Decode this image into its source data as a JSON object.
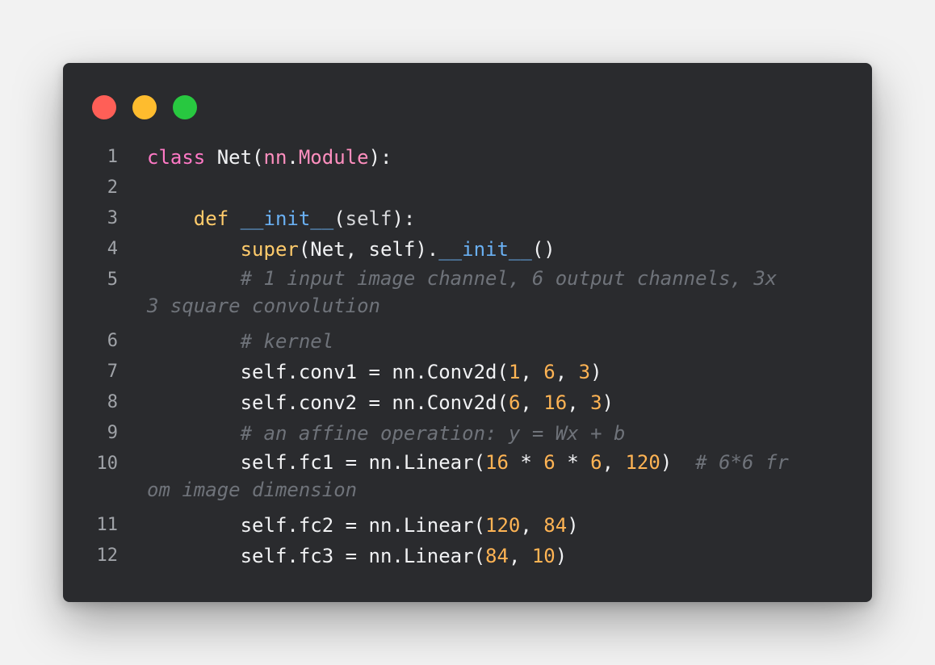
{
  "window": {
    "controls": [
      "close",
      "minimize",
      "maximize"
    ],
    "colors": {
      "close": "#ff5f57",
      "minimize": "#febc2e",
      "maximize": "#28c840",
      "background": "#2a2b2e"
    }
  },
  "code": {
    "language": "python",
    "lines": [
      {
        "n": "1",
        "tokens": [
          {
            "t": "class ",
            "c": "kw2"
          },
          {
            "t": "Net(",
            "c": "plain"
          },
          {
            "t": "nn",
            "c": "cls"
          },
          {
            "t": ".",
            "c": "plain"
          },
          {
            "t": "Module",
            "c": "cls"
          },
          {
            "t": "):",
            "c": "plain"
          }
        ]
      },
      {
        "n": "2",
        "tokens": [
          {
            "t": "",
            "c": "plain"
          }
        ]
      },
      {
        "n": "3",
        "tokens": [
          {
            "t": "    ",
            "c": "plain"
          },
          {
            "t": "def ",
            "c": "kw"
          },
          {
            "t": "__init__",
            "c": "fn"
          },
          {
            "t": "(",
            "c": "plain"
          },
          {
            "t": "self",
            "c": "self"
          },
          {
            "t": "):",
            "c": "plain"
          }
        ]
      },
      {
        "n": "4",
        "tokens": [
          {
            "t": "        ",
            "c": "plain"
          },
          {
            "t": "super",
            "c": "bi"
          },
          {
            "t": "(Net, self).",
            "c": "plain"
          },
          {
            "t": "__init__",
            "c": "fn"
          },
          {
            "t": "()",
            "c": "plain"
          }
        ]
      },
      {
        "n": "5",
        "tokens": [
          {
            "t": "        ",
            "c": "plain"
          },
          {
            "t": "# 1 input image channel, 6 output channels, 3x\n3 square convolution",
            "c": "cmt"
          }
        ]
      },
      {
        "n": "6",
        "tokens": [
          {
            "t": "        ",
            "c": "plain"
          },
          {
            "t": "# kernel",
            "c": "cmt"
          }
        ]
      },
      {
        "n": "7",
        "tokens": [
          {
            "t": "        self.conv1 = nn.Conv2d(",
            "c": "plain"
          },
          {
            "t": "1",
            "c": "num"
          },
          {
            "t": ", ",
            "c": "plain"
          },
          {
            "t": "6",
            "c": "num"
          },
          {
            "t": ", ",
            "c": "plain"
          },
          {
            "t": "3",
            "c": "num"
          },
          {
            "t": ")",
            "c": "plain"
          }
        ]
      },
      {
        "n": "8",
        "tokens": [
          {
            "t": "        self.conv2 = nn.Conv2d(",
            "c": "plain"
          },
          {
            "t": "6",
            "c": "num"
          },
          {
            "t": ", ",
            "c": "plain"
          },
          {
            "t": "16",
            "c": "num"
          },
          {
            "t": ", ",
            "c": "plain"
          },
          {
            "t": "3",
            "c": "num"
          },
          {
            "t": ")",
            "c": "plain"
          }
        ]
      },
      {
        "n": "9",
        "tokens": [
          {
            "t": "        ",
            "c": "plain"
          },
          {
            "t": "# an affine operation: y = Wx + b",
            "c": "cmt"
          }
        ]
      },
      {
        "n": "10",
        "tokens": [
          {
            "t": "        self.fc1 = nn.Linear(",
            "c": "plain"
          },
          {
            "t": "16",
            "c": "num"
          },
          {
            "t": " * ",
            "c": "plain"
          },
          {
            "t": "6",
            "c": "num"
          },
          {
            "t": " * ",
            "c": "plain"
          },
          {
            "t": "6",
            "c": "num"
          },
          {
            "t": ", ",
            "c": "plain"
          },
          {
            "t": "120",
            "c": "num"
          },
          {
            "t": ")  ",
            "c": "plain"
          },
          {
            "t": "# 6*6 fr\nom image dimension",
            "c": "cmt"
          }
        ]
      },
      {
        "n": "11",
        "tokens": [
          {
            "t": "        self.fc2 = nn.Linear(",
            "c": "plain"
          },
          {
            "t": "120",
            "c": "num"
          },
          {
            "t": ", ",
            "c": "plain"
          },
          {
            "t": "84",
            "c": "num"
          },
          {
            "t": ")",
            "c": "plain"
          }
        ]
      },
      {
        "n": "12",
        "tokens": [
          {
            "t": "        self.fc3 = nn.Linear(",
            "c": "plain"
          },
          {
            "t": "84",
            "c": "num"
          },
          {
            "t": ", ",
            "c": "plain"
          },
          {
            "t": "10",
            "c": "num"
          },
          {
            "t": ")",
            "c": "plain"
          }
        ]
      }
    ]
  }
}
